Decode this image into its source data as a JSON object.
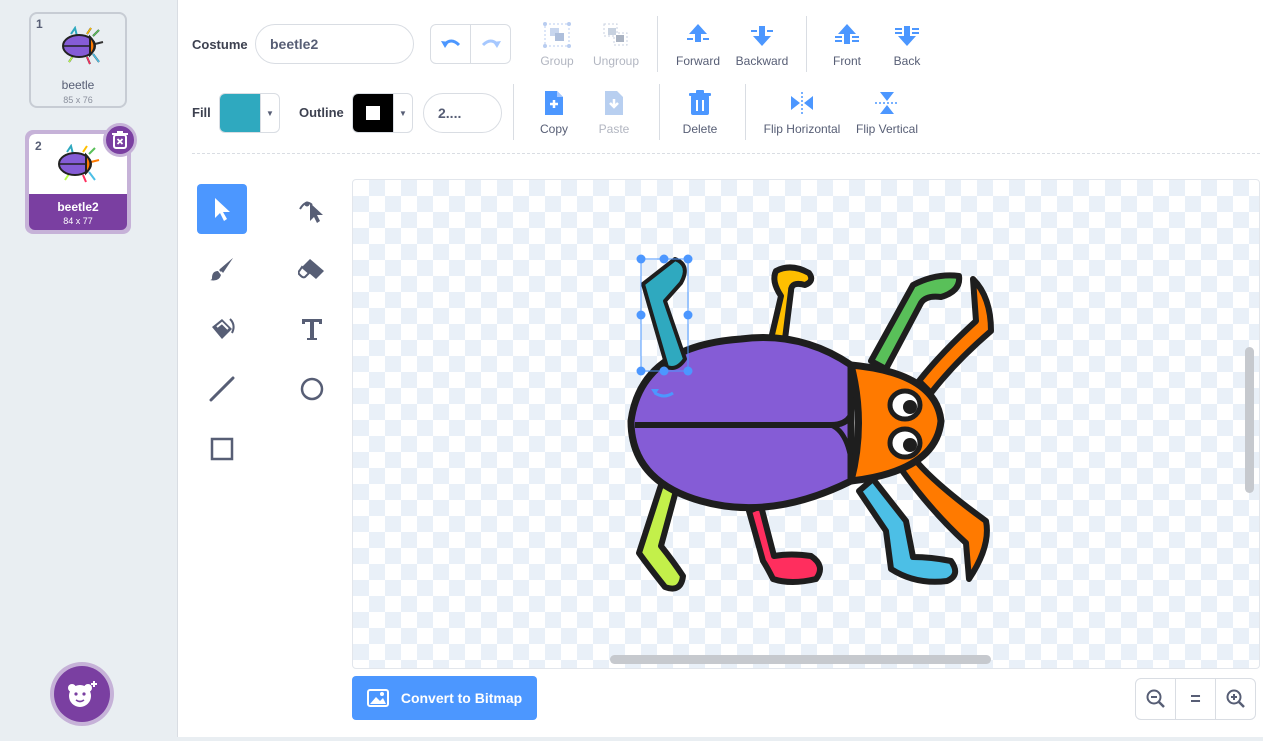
{
  "costumes": [
    {
      "number": "1",
      "name": "beetle",
      "size": "85 x 76",
      "selected": false
    },
    {
      "number": "2",
      "name": "beetle2",
      "size": "84 x 77",
      "selected": true
    }
  ],
  "toolbar": {
    "costume_label": "Costume",
    "costume_name": "beetle2",
    "fill_label": "Fill",
    "outline_label": "Outline",
    "outline_width": "2....",
    "fill_color": "#2fa9bf",
    "outline_color": "#000000",
    "buttons": {
      "group": "Group",
      "ungroup": "Ungroup",
      "forward": "Forward",
      "backward": "Backward",
      "front": "Front",
      "back": "Back",
      "copy": "Copy",
      "paste": "Paste",
      "delete": "Delete",
      "flip_horizontal": "Flip Horizontal",
      "flip_vertical": "Flip Vertical"
    }
  },
  "tools": [
    "select-tool",
    "reshape-tool",
    "brush-tool",
    "eraser-tool",
    "fill-tool",
    "text-tool",
    "line-tool",
    "circle-tool",
    "rectangle-tool"
  ],
  "active_tool": "select-tool",
  "canvas": {
    "convert_button": "Convert to Bitmap",
    "zoom_reset": "="
  },
  "colors": {
    "accent": "#4c97ff",
    "sprite_purple": "#7a3fa1",
    "beetle_body": "#855cd6",
    "beetle_head": "#ff7a00"
  }
}
